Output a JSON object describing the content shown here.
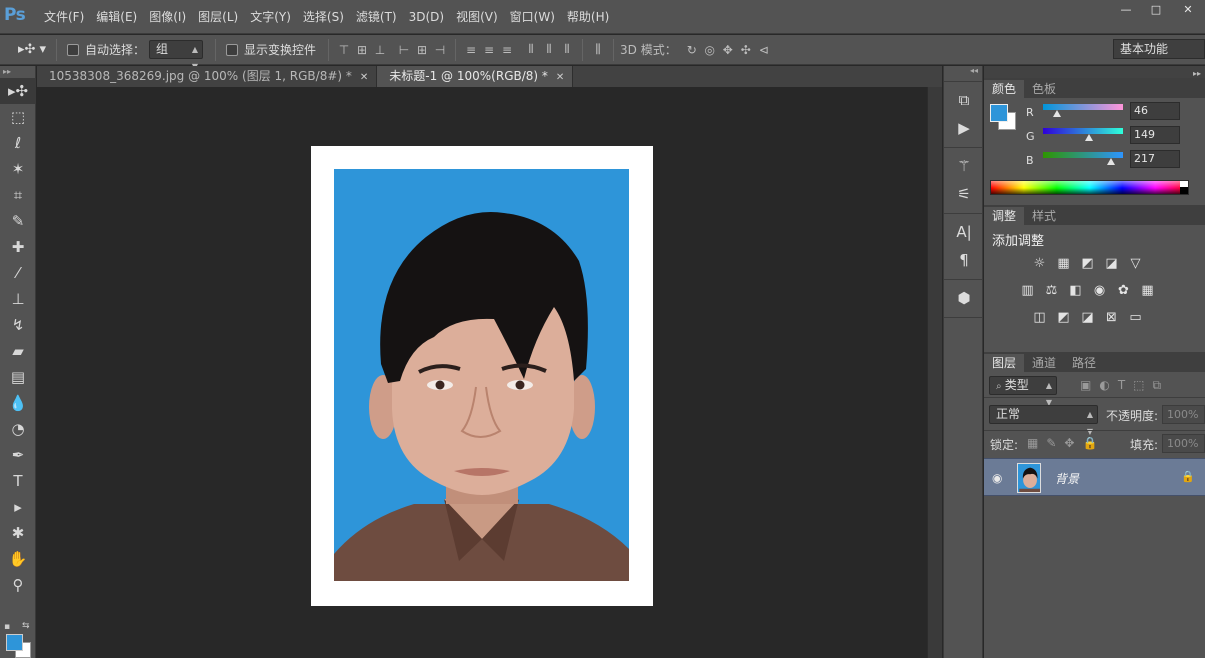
{
  "app": {
    "logo": "Ps"
  },
  "menu": [
    "文件(F)",
    "编辑(E)",
    "图像(I)",
    "图层(L)",
    "文字(Y)",
    "选择(S)",
    "滤镜(T)",
    "3D(D)",
    "视图(V)",
    "窗口(W)",
    "帮助(H)"
  ],
  "window_controls": {
    "minimize": "—",
    "maximize": "□",
    "close": "✕"
  },
  "options_bar": {
    "tool_icon": "move-tool-icon",
    "auto_select_label": "自动选择：",
    "auto_select_value": "组",
    "show_transform_label": "显示变换控件",
    "mode_3d_label": "3D 模式：",
    "workspace": "基本功能"
  },
  "tabs": [
    {
      "label": "10538308_368269.jpg @ 100% (图层 1, RGB/8#) *",
      "close": "✕"
    },
    {
      "label": "未标题-1 @ 100%(RGB/8) *",
      "close": "✕"
    }
  ],
  "colors": {
    "foreground": "#2e95d9",
    "background": "#ffffff",
    "photo_bg": "#2e95d9"
  },
  "color_panel": {
    "tabs": [
      "颜色",
      "色板"
    ],
    "channels": [
      {
        "name": "R",
        "value": "46",
        "fraction": 0.18
      },
      {
        "name": "G",
        "value": "149",
        "fraction": 0.58
      },
      {
        "name": "B",
        "value": "217",
        "fraction": 0.85
      }
    ]
  },
  "adjust_panel": {
    "tabs": [
      "调整",
      "样式"
    ],
    "title": "添加调整"
  },
  "layers_panel": {
    "tabs": [
      "图层",
      "通道",
      "路径"
    ],
    "filter_label": "类型",
    "blend_mode": "正常",
    "opacity_label": "不透明度:",
    "opacity_value": "100%",
    "lock_label": "锁定:",
    "fill_label": "填充:",
    "fill_value": "100%",
    "layers": [
      {
        "name": "背景"
      }
    ]
  }
}
